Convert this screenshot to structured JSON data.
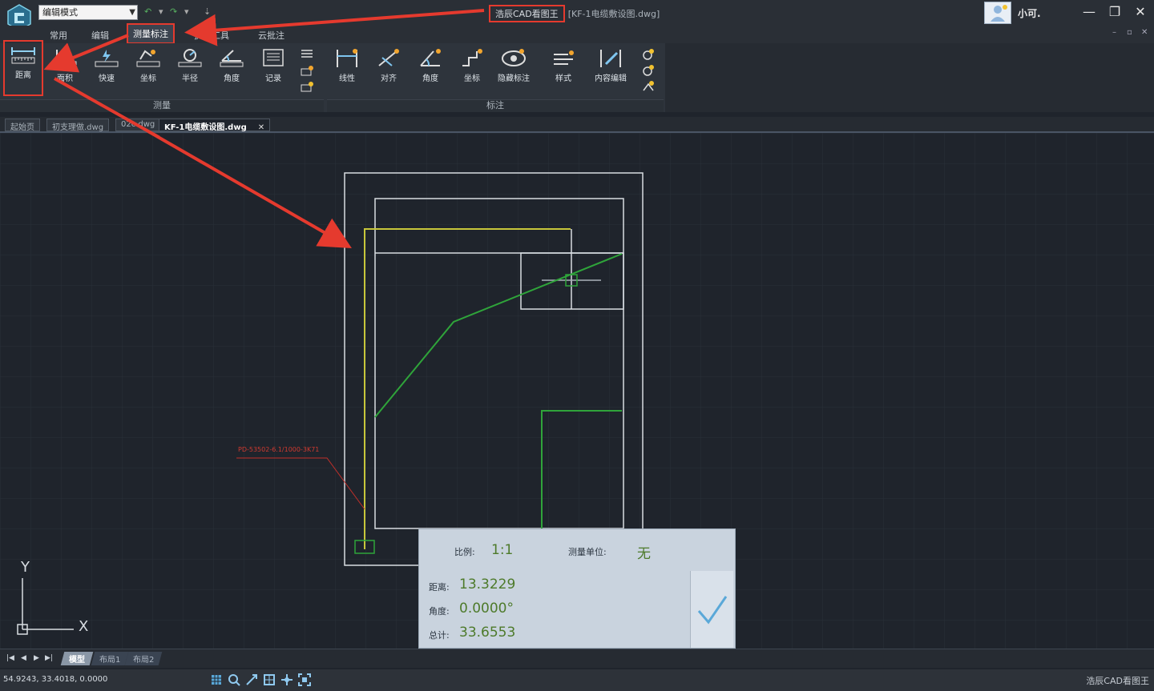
{
  "titlebar": {
    "mode": "编辑模式",
    "app_name": "浩辰CAD看图王",
    "file_name": "[KF-1电缆敷设图.dwg]",
    "user_name": "小可.",
    "minimize": "—",
    "restore": "❐",
    "close": "✕"
  },
  "menu": {
    "tabs": [
      "常用",
      "编辑",
      "测量标注",
      "扩展工具",
      "云批注"
    ]
  },
  "ribbon": {
    "measure_group": "测量",
    "annotate_group": "标注",
    "measure_tools": [
      "距离",
      "面积",
      "快速",
      "坐标",
      "半径",
      "角度",
      "记录"
    ],
    "annotate_tools": [
      "线性",
      "对齐",
      "角度",
      "坐标",
      "隐藏标注",
      "样式",
      "内容编辑"
    ]
  },
  "doc_tabs": [
    "起始页",
    "初支理做.dwg",
    "02c.dwg",
    "KF-1电缆敷设图.dwg"
  ],
  "doc_tab_close": "✕",
  "drawing": {
    "callout": "PD-53502-6.1/1000-3K71"
  },
  "axes": {
    "y": "Y",
    "x": "X"
  },
  "measure": {
    "scale_label": "比例:",
    "scale_value": "1:1",
    "unit_label": "测量单位:",
    "unit_value": "无",
    "distance_label": "距离:",
    "distance_value": "13.3229",
    "angle_label": "角度:",
    "angle_value": "0.0000°",
    "total_label": "总计:",
    "total_value": "33.6553"
  },
  "layout_tabs": [
    "模型",
    "布局1",
    "布局2"
  ],
  "status": {
    "coords": "54.9243, 33.4018, 0.0000",
    "brand": "浩辰CAD看图王"
  },
  "colors": {
    "accent_red": "#e53a2e",
    "drawing_green": "#2fa43a",
    "drawing_yellow": "#c7c63a",
    "drawing_white": "#d8dde2",
    "value_green": "#4d7a2a"
  }
}
